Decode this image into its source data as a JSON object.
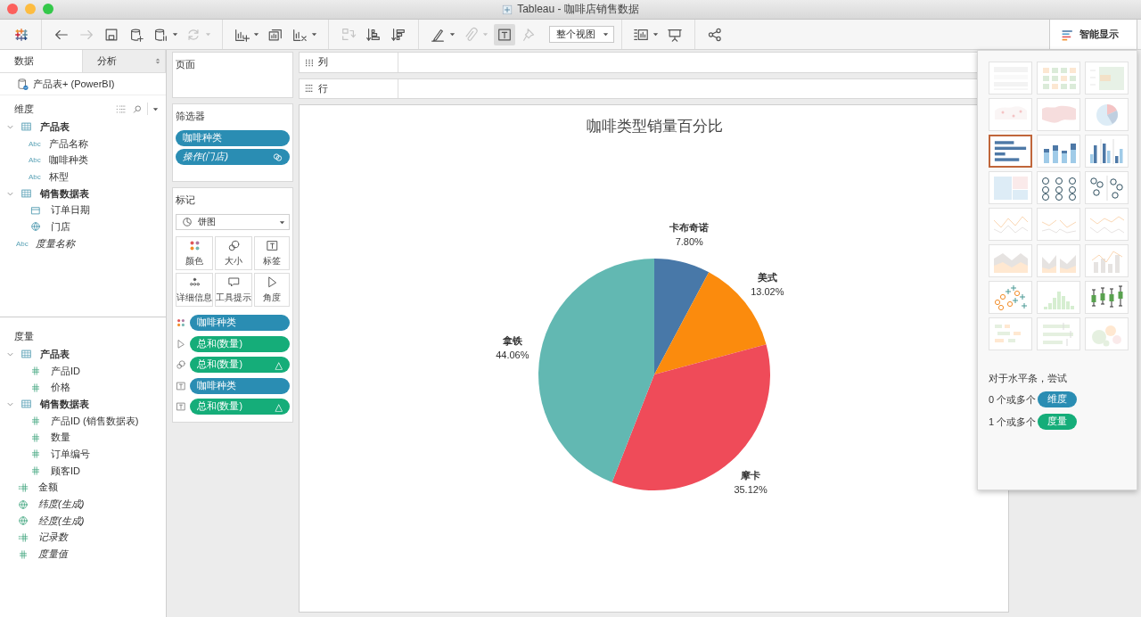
{
  "window": {
    "title": "Tableau - 咖啡店销售数据"
  },
  "toolbar": [
    {
      "kind": "logo"
    },
    {
      "kind": "separator"
    },
    {
      "kind": "back",
      "disabled": false,
      "dropdown": false,
      "pressed": false
    },
    {
      "kind": "forward",
      "disabled": true,
      "dropdown": false,
      "pressed": false
    },
    {
      "kind": "save",
      "disabled": false,
      "dropdown": false,
      "pressed": false
    },
    {
      "kind": "new-data-source",
      "disabled": false,
      "dropdown": false,
      "pressed": false
    },
    {
      "kind": "pause-updates",
      "disabled": false,
      "dropdown": true,
      "pressed": false
    },
    {
      "kind": "refresh",
      "disabled": true,
      "dropdown": true,
      "pressed": false
    },
    {
      "kind": "separator"
    },
    {
      "kind": "new-sheet",
      "disabled": false,
      "dropdown": true,
      "pressed": false
    },
    {
      "kind": "duplicate-sheet",
      "disabled": false,
      "dropdown": false,
      "pressed": false
    },
    {
      "kind": "clear-sheet",
      "disabled": false,
      "dropdown": true,
      "pressed": false
    },
    {
      "kind": "separator"
    },
    {
      "kind": "swap",
      "disabled": true,
      "dropdown": false,
      "pressed": false
    },
    {
      "kind": "sort-ascending",
      "disabled": false,
      "dropdown": false,
      "pressed": false
    },
    {
      "kind": "sort-descending",
      "disabled": false,
      "dropdown": false,
      "pressed": false
    },
    {
      "kind": "separator"
    },
    {
      "kind": "highlight",
      "disabled": false,
      "dropdown": true,
      "pressed": false
    },
    {
      "kind": "group",
      "disabled": true,
      "dropdown": true,
      "pressed": false
    },
    {
      "kind": "show-labels",
      "disabled": false,
      "dropdown": false,
      "pressed": true
    },
    {
      "kind": "fix-axes",
      "disabled": true,
      "dropdown": false,
      "pressed": false
    },
    {
      "kind": "fit",
      "value": "整个视图"
    },
    {
      "kind": "separator"
    },
    {
      "kind": "cards",
      "disabled": false,
      "dropdown": true,
      "pressed": false
    },
    {
      "kind": "presentation",
      "disabled": false,
      "dropdown": false,
      "pressed": false
    },
    {
      "kind": "separator"
    },
    {
      "kind": "share",
      "disabled": false,
      "dropdown": false,
      "pressed": false
    }
  ],
  "data_pane": {
    "tabs": [
      {
        "label": "数据",
        "selected": true
      },
      {
        "label": "分析",
        "selected": false
      }
    ],
    "data_source": "产品表+ (PowerBI)",
    "dimensions": {
      "title": "维度",
      "items": [
        {
          "name": "产品表",
          "kind": "table",
          "expanded": true,
          "children": [
            {
              "name": "产品名称",
              "kind": "string",
              "badge": "Abc",
              "italic": false
            },
            {
              "name": "咖啡种类",
              "kind": "string",
              "badge": "Abc",
              "italic": false
            },
            {
              "name": "杯型",
              "kind": "string",
              "badge": "Abc",
              "italic": false
            }
          ]
        },
        {
          "name": "销售数据表",
          "kind": "table",
          "expanded": true,
          "children": [
            {
              "name": "订单日期",
              "kind": "date",
              "italic": false
            },
            {
              "name": "门店",
              "kind": "geo",
              "italic": false
            }
          ]
        },
        {
          "name": "度量名称",
          "kind": "string",
          "badge": "Abc",
          "italic": true
        }
      ]
    },
    "measures": {
      "title": "度量",
      "items": [
        {
          "name": "产品表",
          "kind": "table",
          "expanded": true,
          "children": [
            {
              "name": "产品ID",
              "kind": "number",
              "italic": false
            },
            {
              "name": "价格",
              "kind": "number",
              "italic": false
            }
          ]
        },
        {
          "name": "销售数据表",
          "kind": "table",
          "expanded": true,
          "children": [
            {
              "name": "产品ID (销售数据表)",
              "kind": "number",
              "italic": false
            },
            {
              "name": "数量",
              "kind": "number",
              "italic": false
            },
            {
              "name": "订单编号",
              "kind": "number",
              "italic": false
            },
            {
              "name": "顾客ID",
              "kind": "number",
              "italic": false
            }
          ]
        },
        {
          "name": "金额",
          "kind": "calc-number",
          "italic": false
        },
        {
          "name": "纬度(生成)",
          "kind": "geo",
          "italic": true
        },
        {
          "name": "经度(生成)",
          "kind": "geo",
          "italic": true
        },
        {
          "name": "记录数",
          "kind": "calc-number",
          "italic": true
        },
        {
          "name": "度量值",
          "kind": "number",
          "italic": true
        }
      ]
    }
  },
  "cards": {
    "pages": {
      "title": "页面"
    },
    "filters": {
      "title": "筛选器",
      "pills": [
        {
          "label": "咖啡种类",
          "measure": false,
          "italic": false,
          "linked": false
        },
        {
          "label": "操作(门店)",
          "measure": false,
          "italic": true,
          "linked": true
        }
      ]
    },
    "marks": {
      "title": "标记",
      "mark_type": "饼图",
      "buttons": [
        {
          "label": "颜色",
          "kind": "color"
        },
        {
          "label": "大小",
          "kind": "size"
        },
        {
          "label": "标签",
          "kind": "label"
        },
        {
          "label": "详细信息",
          "kind": "detail"
        },
        {
          "label": "工具提示",
          "kind": "tooltip"
        },
        {
          "label": "角度",
          "kind": "angle"
        }
      ],
      "pills": [
        {
          "kind": "color",
          "label": "咖啡种类",
          "measure": false
        },
        {
          "kind": "angle",
          "label": "总和(数量)",
          "measure": true
        },
        {
          "kind": "size",
          "label": "总和(数量)",
          "measure": true,
          "delta": "△"
        },
        {
          "kind": "label",
          "label": "咖啡种类",
          "measure": false
        },
        {
          "kind": "label",
          "label": "总和(数量)",
          "measure": true,
          "delta": "△"
        }
      ]
    }
  },
  "shelves": [
    {
      "label": "列",
      "kind": "columns"
    },
    {
      "label": "行",
      "kind": "rows"
    }
  ],
  "sheet": {
    "chart_data": {
      "type": "pie",
      "title": "咖啡类型销量百分比",
      "categories": [
        "卡布奇诺",
        "美式",
        "摩卡",
        "拿铁"
      ],
      "values": [
        7.8,
        13.02,
        35.12,
        44.06
      ],
      "colors": [
        "#4878a8",
        "#fb8b0d",
        "#ef4b59",
        "#62b8b2"
      ],
      "value_labels": [
        "7.80%",
        "13.02%",
        "35.12%",
        "44.06%"
      ]
    }
  },
  "show_me": {
    "button": "智能显示",
    "active": true,
    "charts": [
      {
        "kind": "text-table",
        "selected": false,
        "enabled": false
      },
      {
        "kind": "heat-map",
        "selected": false,
        "enabled": false
      },
      {
        "kind": "highlight-table",
        "selected": false,
        "enabled": false
      },
      {
        "kind": "symbol-map",
        "selected": false,
        "enabled": false
      },
      {
        "kind": "filled-map",
        "selected": false,
        "enabled": false
      },
      {
        "kind": "pie-chart",
        "selected": false,
        "enabled": false
      },
      {
        "kind": "bar-chart",
        "selected": true,
        "enabled": true
      },
      {
        "kind": "stacked-bar-chart",
        "selected": false,
        "enabled": true
      },
      {
        "kind": "side-by-side-bar-chart",
        "selected": false,
        "enabled": true
      },
      {
        "kind": "treemap",
        "selected": false,
        "enabled": false
      },
      {
        "kind": "circle-view",
        "selected": false,
        "enabled": true
      },
      {
        "kind": "side-by-side-circle-view",
        "selected": false,
        "enabled": true
      },
      {
        "kind": "line-chart",
        "selected": false,
        "enabled": false
      },
      {
        "kind": "discrete-line-chart",
        "selected": false,
        "enabled": false
      },
      {
        "kind": "dual-line-chart",
        "selected": false,
        "enabled": false
      },
      {
        "kind": "area-chart",
        "selected": false,
        "enabled": false
      },
      {
        "kind": "discrete-area-chart",
        "selected": false,
        "enabled": false
      },
      {
        "kind": "dual-combination-chart",
        "selected": false,
        "enabled": false
      },
      {
        "kind": "scatter-plot",
        "selected": false,
        "enabled": true
      },
      {
        "kind": "histogram",
        "selected": false,
        "enabled": false
      },
      {
        "kind": "box-plot",
        "selected": false,
        "enabled": true
      },
      {
        "kind": "gantt-chart",
        "selected": false,
        "enabled": false
      },
      {
        "kind": "bullet-graph",
        "selected": false,
        "enabled": false
      },
      {
        "kind": "packed-bubbles",
        "selected": false,
        "enabled": false
      }
    ],
    "hint": "对于水平条，尝试",
    "requirements": [
      {
        "count": "0 个或多个",
        "label": "维度",
        "kind": "dimension"
      },
      {
        "count": "1 个或多个",
        "label": "度量",
        "kind": "measure"
      }
    ]
  }
}
